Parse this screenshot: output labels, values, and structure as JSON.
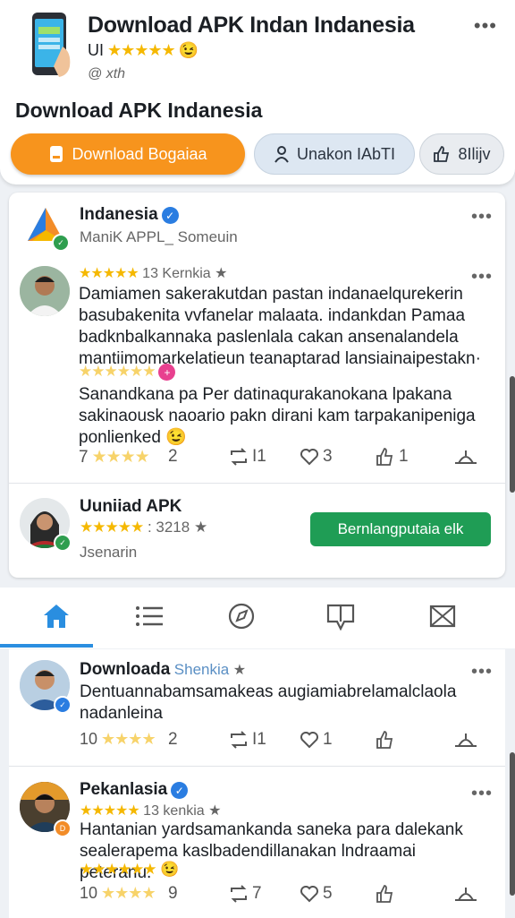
{
  "header": {
    "title": "Download APK Indan Indanesia",
    "subtitle_prefix": "UI",
    "subtitle_stars": "★★★★★",
    "emoji": "😉",
    "meta": "@ хth",
    "section_title": "Download APK Indanesia",
    "more_icon": "more-dots-icon"
  },
  "buttons": {
    "primary_label": "Download Bogaiaa",
    "secondary_label": "Unakon IAbTI",
    "third_label": "8Ilijv"
  },
  "app_card": {
    "name": "Indanesia",
    "subline": "ManiK APPL_ Someuin"
  },
  "review1": {
    "rating_stars": "★★★★★",
    "rating_text": "13 Kernkia",
    "text": "Damiamen sakerakutdan pastan indanaelqurekerin basubakenita vvfanelar malaata. indankdan Pamaa badknbalkannaka paslenlala cakan ansenalandela mantiimomarkelatieun teanaptarad lansiainaipestakn·",
    "rating2_stars": "★★★★★★",
    "text2": "Sanandkana pa Per datinaqurakanokana lpakana sakinaousk naoario pakn dirani kam tarpakanipeniga ponlienked",
    "emoji2": "😉",
    "actions": {
      "score": "7",
      "score_stars": "★★★★",
      "comments": "2",
      "reposts": "I1",
      "likes": "3",
      "shares": "1"
    }
  },
  "uniad": {
    "name": "Uuniiad APK",
    "rating_stars": "★★★★★",
    "rating_text": ": 3218",
    "subline": "Jsenarin",
    "button_label": "Bernlangputaia elk"
  },
  "nav": {
    "items": [
      "home-icon",
      "list-icon",
      "compass-icon",
      "map-icon",
      "mail-icon"
    ]
  },
  "feed": [
    {
      "name": "Downloada",
      "tag": "Shenkia",
      "text": "Dentuannabamsamakeas augiamiabrelamalclaola nadanleina",
      "score": "10",
      "score_stars": "★★★★",
      "comments": "2",
      "reposts": "I1",
      "likes": "1"
    },
    {
      "name": "Pekanlasia",
      "rating_stars": "★★★★★",
      "rating_text": "13 kenkia",
      "text": "Hantanian yardsamankanda saneka para dalekank sealerapema kaslbadendillanakan lndraamai peteranu.",
      "rating2_stars": "★★★★★★",
      "emoji": "😉",
      "score": "10",
      "score_stars": "★★★★",
      "comments": "9",
      "reposts": "7",
      "likes": "5"
    }
  ],
  "colors": {
    "primary": "#f7941d",
    "accent_blue": "#2a8ee0",
    "green": "#1f9d55",
    "star": "#f5b800"
  }
}
